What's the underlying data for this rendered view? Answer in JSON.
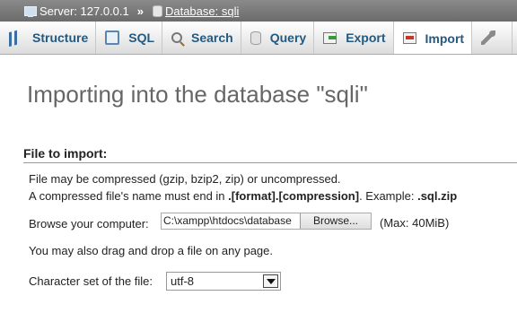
{
  "breadcrumb": {
    "server": "Server: 127.0.0.1",
    "separator": "»",
    "database": "Database: sqli"
  },
  "tabs": [
    {
      "label": "Structure",
      "icon": "structure-icon"
    },
    {
      "label": "SQL",
      "icon": "sql-icon"
    },
    {
      "label": "Search",
      "icon": "search-icon"
    },
    {
      "label": "Query",
      "icon": "query-icon"
    },
    {
      "label": "Export",
      "icon": "export-icon"
    },
    {
      "label": "Import",
      "icon": "import-icon",
      "active": true
    },
    {
      "label": "",
      "icon": "wrench-icon"
    }
  ],
  "main": {
    "title": "Importing into the database \"sqli\"",
    "section_title": "File to import:",
    "compress_note": "File may be compressed (gzip, bzip2, zip) or uncompressed.",
    "format_note_prefix": "A compressed file's name must end in ",
    "format_note_bold": ".[format].[compression]",
    "format_note_mid": ". Example: ",
    "format_note_example": ".sql.zip",
    "browse_label": "Browse your computer:",
    "file_path": "C:\\xampp\\htdocs\\database",
    "browse_button": "Browse...",
    "max_size": "(Max: 40MiB)",
    "drag_note": "You may also drag and drop a file on any page.",
    "charset_label": "Character set of the file:",
    "charset_value": "utf-8"
  }
}
